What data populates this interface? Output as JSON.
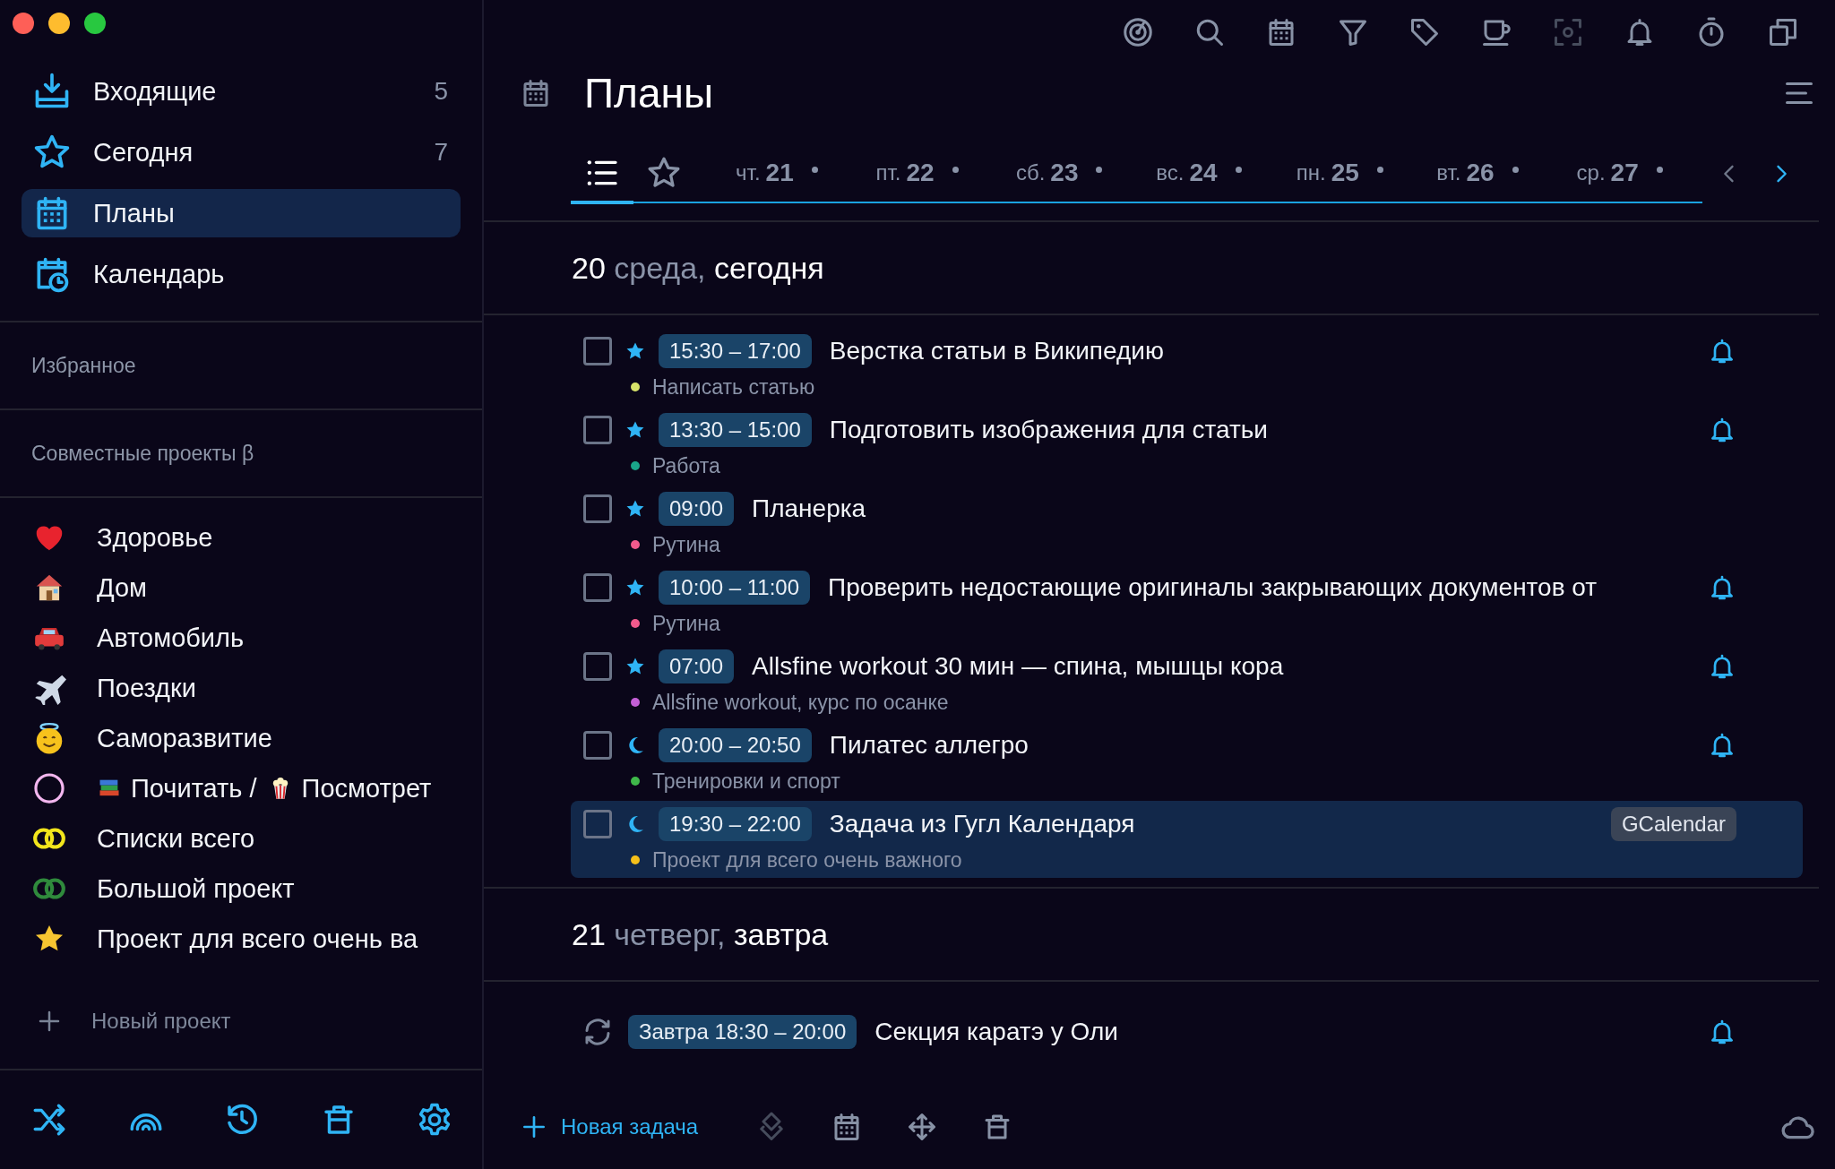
{
  "window": {
    "controls": [
      {
        "color": "#fe5f57"
      },
      {
        "color": "#febc2e"
      },
      {
        "color": "#28c840"
      }
    ]
  },
  "sidebar": {
    "nav": [
      {
        "kind": "inbox",
        "label": "Входящие",
        "count": "5",
        "selected": false
      },
      {
        "kind": "today",
        "label": "Сегодня",
        "count": "7",
        "selected": false
      },
      {
        "kind": "plans",
        "label": "Планы",
        "selected": true
      },
      {
        "kind": "calendar",
        "label": "Календарь",
        "selected": false
      }
    ],
    "sections": [
      "Избранное",
      "Совместные проекты β"
    ],
    "projects": [
      {
        "kind": "heart",
        "label": "Здоровье"
      },
      {
        "kind": "house",
        "label": "Дом"
      },
      {
        "kind": "car",
        "label": "Автомобиль"
      },
      {
        "kind": "plane",
        "label": "Поездки"
      },
      {
        "kind": "smiley",
        "label": "Саморазвитие"
      },
      {
        "kind": "ring",
        "color": "#f3b6ef",
        "parts": [
          {
            "kind": "books",
            "text": "Почитать /"
          },
          {
            "kind": "popcorn",
            "text": "Посмотрет"
          }
        ]
      },
      {
        "kind": "double-ring",
        "color": "#f2e51c",
        "label": "Списки всего"
      },
      {
        "kind": "double-ring",
        "color": "#2f8a3c",
        "label": "Большой проект"
      },
      {
        "kind": "star",
        "label": "Проект для всего очень ва"
      }
    ],
    "new_project": "Новый проект"
  },
  "toolbar": [
    {
      "kind": "radar",
      "disabled": false
    },
    {
      "kind": "search",
      "disabled": false
    },
    {
      "kind": "calendar",
      "disabled": false
    },
    {
      "kind": "filter",
      "disabled": false
    },
    {
      "kind": "tag",
      "disabled": false
    },
    {
      "kind": "cup",
      "disabled": false
    },
    {
      "kind": "focus",
      "disabled": true
    },
    {
      "kind": "bell",
      "disabled": false
    },
    {
      "kind": "timer",
      "disabled": false
    },
    {
      "kind": "copy",
      "disabled": false
    }
  ],
  "title": "Планы",
  "tabs": [
    {
      "kind": "list",
      "selected": true
    },
    {
      "kind": "star",
      "selected": false
    },
    {
      "kind": "day",
      "weekday": "чт.",
      "day": "21",
      "has_tasks": true,
      "selected": false
    },
    {
      "kind": "day",
      "weekday": "пт.",
      "day": "22",
      "has_tasks": true,
      "selected": false
    },
    {
      "kind": "day",
      "weekday": "сб.",
      "day": "23",
      "has_tasks": true,
      "selected": false
    },
    {
      "kind": "day",
      "weekday": "вс.",
      "day": "24",
      "has_tasks": true,
      "selected": false
    },
    {
      "kind": "day",
      "weekday": "пн.",
      "day": "25",
      "has_tasks": true,
      "selected": false
    },
    {
      "kind": "day",
      "weekday": "вт.",
      "day": "26",
      "has_tasks": true,
      "selected": false
    },
    {
      "kind": "day",
      "weekday": "ср.",
      "day": "27",
      "has_tasks": true,
      "selected": false
    }
  ],
  "pager": [
    {
      "kind": "prev",
      "disabled": true
    },
    {
      "kind": "next",
      "disabled": false
    }
  ],
  "days": [
    {
      "date": "20",
      "weekday": "среда,",
      "label": "сегодня",
      "tasks": [
        {
          "kind": "task",
          "checked": false,
          "evening": false,
          "time": "15:30 – 17:00",
          "title": "Верстка статьи в Википедию",
          "project": "Написать статью",
          "color": "#d8e36a",
          "reminder": true,
          "selected": false
        },
        {
          "kind": "task",
          "checked": false,
          "evening": false,
          "time": "13:30 – 15:00",
          "title": "Подготовить изображения для статьи",
          "project": "Работа",
          "color": "#1aa58a",
          "reminder": true,
          "selected": false
        },
        {
          "kind": "task",
          "checked": false,
          "evening": false,
          "time": "09:00",
          "title": "Планерка",
          "project": "Рутина",
          "color": "#f25a8c",
          "reminder": false,
          "selected": false
        },
        {
          "kind": "task",
          "checked": false,
          "evening": false,
          "time": "10:00 – 11:00",
          "title": "Проверить недостающие оригиналы закрывающих документов от",
          "project": "Рутина",
          "color": "#f25a8c",
          "reminder": true,
          "selected": false
        },
        {
          "kind": "task",
          "checked": false,
          "evening": false,
          "time": "07:00",
          "title": "Allsfine workout 30 мин — спина, мышцы кора",
          "project": "Allsfine workout, курс по осанке",
          "color": "#c45fd6",
          "reminder": true,
          "selected": false
        },
        {
          "kind": "task",
          "checked": false,
          "evening": true,
          "time": "20:00 – 20:50",
          "title": "Пилатес аллегро",
          "project": "Тренировки и спорт",
          "color": "#3fb84a",
          "reminder": true,
          "selected": false
        },
        {
          "kind": "task",
          "checked": false,
          "evening": true,
          "time": "19:30 – 22:00",
          "title": "Задача из Гугл Календаря",
          "project": "Проект для всего очень важного",
          "color": "#f5c01a",
          "reminder": false,
          "tag": "GCalendar",
          "selected": true
        }
      ]
    },
    {
      "date": "21",
      "weekday": "четверг,",
      "label": "завтра",
      "tasks": [
        {
          "kind": "recurring",
          "time": "Завтра 18:30 – 20:00",
          "title": "Секция каратэ у Оли",
          "reminder": true,
          "selected": false
        }
      ]
    }
  ],
  "bottom": {
    "new_task": "Новая задача",
    "actions": [
      {
        "kind": "layers",
        "disabled": true
      },
      {
        "kind": "calendar",
        "disabled": false
      },
      {
        "kind": "move",
        "disabled": false
      },
      {
        "kind": "trash",
        "disabled": false
      }
    ]
  }
}
